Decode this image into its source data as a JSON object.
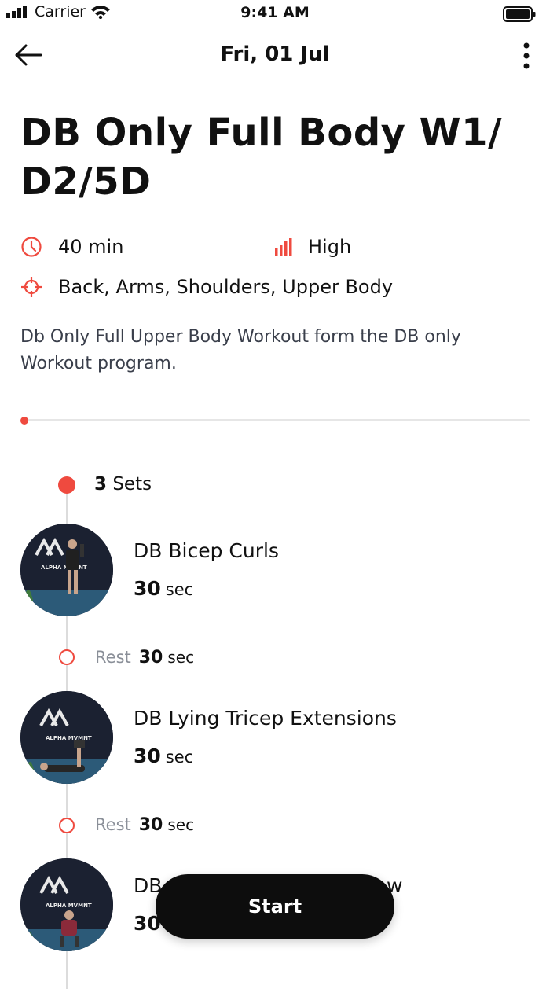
{
  "status_bar": {
    "carrier": "Carrier",
    "time": "9:41 AM"
  },
  "nav": {
    "title": "Fri, 01 Jul"
  },
  "workout": {
    "title": "DB Only Full Body W1/ D2/5D",
    "duration": "40 min",
    "intensity": "High",
    "focus": "Back, Arms, Shoulders, Upper Body",
    "description": "Db Only Full Upper Body Workout form the DB only Workout program."
  },
  "progress": {
    "value": 0
  },
  "sets": {
    "count": "3",
    "label": "Sets"
  },
  "exercises": [
    {
      "name": "DB Bicep Curls",
      "duration": "30",
      "unit": "sec"
    },
    {
      "name": "DB Lying Tricep Extensions",
      "duration": "30",
      "unit": "sec"
    },
    {
      "name_partial": "DB",
      "name_tail": "w",
      "duration_partial": "30"
    }
  ],
  "rests": [
    {
      "label": "Rest",
      "duration": "30",
      "unit": "sec"
    },
    {
      "label": "Rest",
      "duration": "30",
      "unit": "sec"
    }
  ],
  "thumb_text": "ALPHA MVMNT",
  "start_button": {
    "label": "Start"
  },
  "colors": {
    "accent": "#ef4a3f",
    "text": "#111111",
    "muted": "#8a8f98",
    "button": "#0d0d0d"
  }
}
